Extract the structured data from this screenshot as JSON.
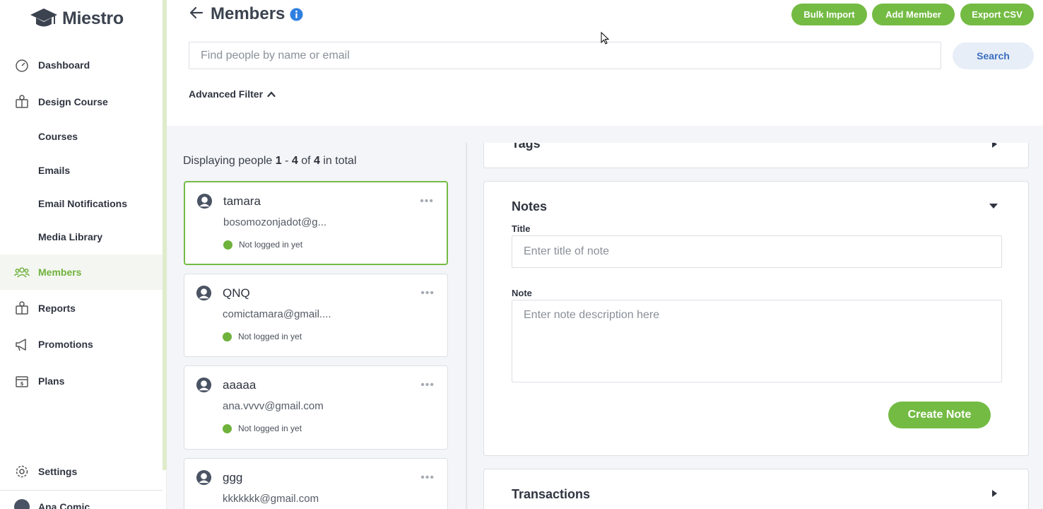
{
  "brand": {
    "name": "Miestro",
    "accent": "#74bb44",
    "icon": "graduation-cap-icon"
  },
  "sidebar": {
    "items": [
      {
        "label": "Dashboard",
        "icon": "dashboard-gauge-icon"
      },
      {
        "label": "Design Course",
        "icon": "design-course-icon"
      },
      {
        "label": "Courses"
      },
      {
        "label": "Emails"
      },
      {
        "label": "Email Notifications"
      },
      {
        "label": "Media Library"
      },
      {
        "label": "Members",
        "icon": "users-group-icon",
        "active": true
      },
      {
        "label": "Reports",
        "icon": "reports-icon"
      },
      {
        "label": "Promotions",
        "icon": "megaphone-icon"
      },
      {
        "label": "Plans",
        "icon": "plans-icon"
      }
    ],
    "settings_label": "Settings",
    "user_name": "Ana Comic"
  },
  "header": {
    "title": "Members",
    "buttons": {
      "bulk_import": "Bulk Import",
      "add_member": "Add Member",
      "export_csv": "Export CSV"
    },
    "search": {
      "placeholder": "Find people by name or email",
      "value": "",
      "button": "Search"
    },
    "advanced_filter": "Advanced Filter"
  },
  "list": {
    "display_prefix": "Displaying people ",
    "range_start": "1",
    "range_sep": " - ",
    "range_end": "4",
    "of_text": " of ",
    "total": "4",
    "suffix": " in total",
    "members": [
      {
        "name": "tamara",
        "email": "bosomozonjadot@g...",
        "status": "Not logged in yet",
        "selected": true
      },
      {
        "name": "QNQ",
        "email": "comictamara@gmail....",
        "status": "Not logged in yet"
      },
      {
        "name": "aaaaa",
        "email": "ana.vvvv@gmail.com",
        "status": "Not logged in yet"
      },
      {
        "name": "ggg",
        "email": "kkkkkkk@gmail.com",
        "status": "Not logged in yet"
      }
    ],
    "more_symbol": "•••"
  },
  "detail": {
    "tags_title": "Tags",
    "notes": {
      "title": "Notes",
      "title_label": "Title",
      "title_placeholder": "Enter title of note",
      "note_label": "Note",
      "note_placeholder": "Enter note description here",
      "create_button": "Create Note"
    },
    "transactions_title": "Transactions"
  }
}
